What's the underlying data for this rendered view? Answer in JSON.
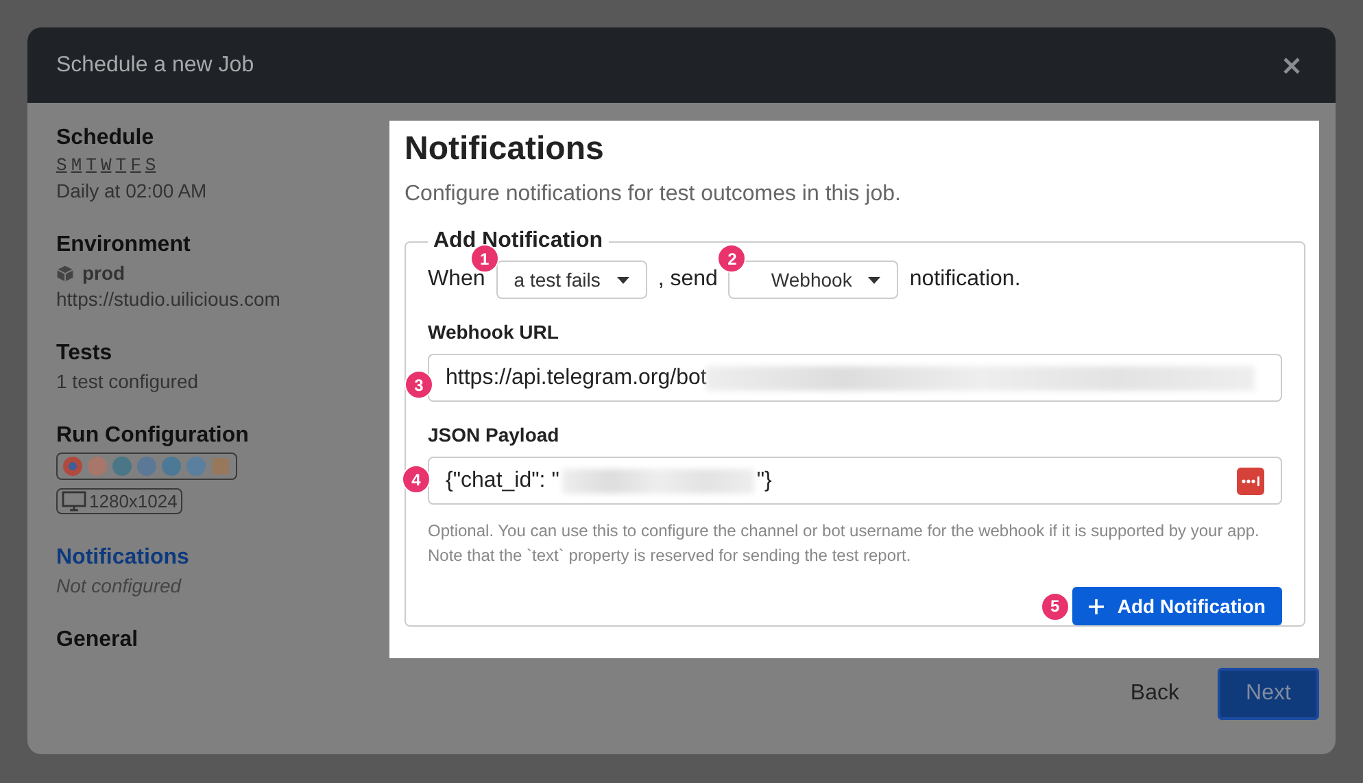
{
  "dialog": {
    "title": "Schedule a new Job"
  },
  "sidebar": [
    {
      "kind": "schedule",
      "heading": "Schedule",
      "days": [
        "S",
        "M",
        "T",
        "W",
        "T",
        "F",
        "S"
      ],
      "text": "Daily at 02:00 AM",
      "selected": false
    },
    {
      "kind": "environment",
      "heading": "Environment",
      "name": "prod",
      "text": "https://studio.uilicious.com",
      "selected": false
    },
    {
      "kind": "plain",
      "heading": "Tests",
      "text": "1 test configured",
      "selected": false
    },
    {
      "kind": "run",
      "heading": "Run Configuration",
      "resolution": "1280x1024",
      "selected": false
    },
    {
      "kind": "status",
      "heading": "Notifications",
      "text": "Not configured",
      "selected": true
    },
    {
      "kind": "plain",
      "heading": "General",
      "selected": false
    }
  ],
  "panel": {
    "title": "Notifications",
    "subtitle": "Configure notifications for test outcomes in this job.",
    "legend": "Add Notification",
    "sentence": {
      "when": "When",
      "trigger": {
        "value": "a test fails",
        "marker": "1"
      },
      "send": ", send",
      "channel": {
        "value": "Webhook",
        "marker": "2"
      },
      "end": "notification."
    },
    "webhook_url": {
      "label": "Webhook URL",
      "value": "https://api.telegram.org/bot",
      "marker": "3"
    },
    "json_payload": {
      "label": "JSON Payload",
      "value_start": "{\"chat_id\": \"",
      "value_end": "\"}",
      "marker": "4"
    },
    "help": "Optional. You can use this to configure the channel or bot username for the webhook if it is supported by your app. Note that the `text` property is reserved for sending the test report.",
    "add_button": {
      "label": "Add Notification",
      "marker": "5"
    }
  },
  "footer": {
    "back": "Back",
    "next": "Next"
  }
}
